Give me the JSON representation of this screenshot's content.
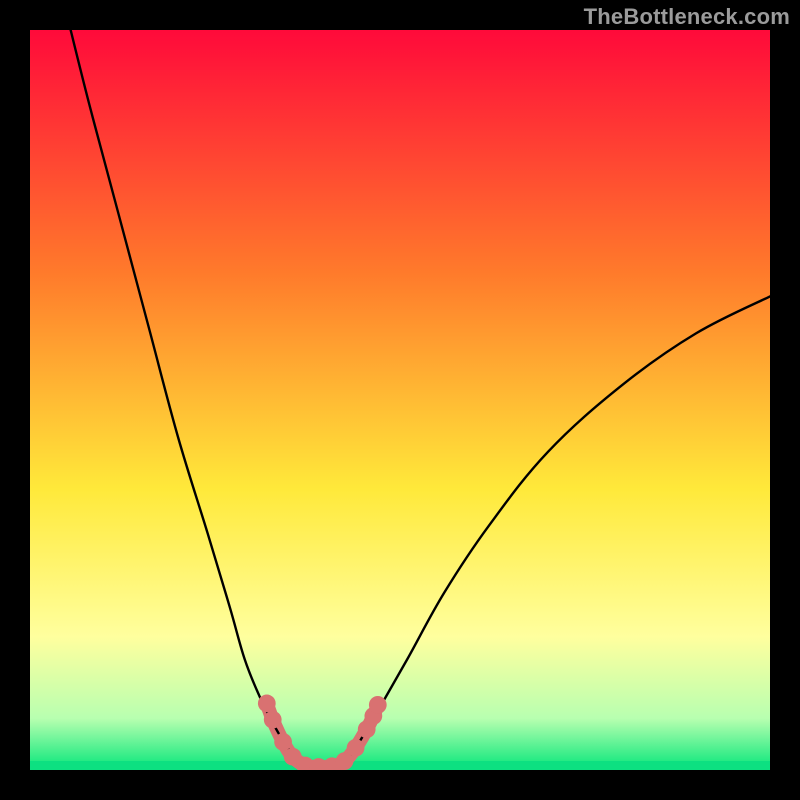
{
  "watermark": "TheBottleneck.com",
  "chart_data": {
    "type": "line",
    "title": "",
    "xlabel": "",
    "ylabel": "",
    "xlim": [
      0,
      100
    ],
    "ylim": [
      0,
      100
    ],
    "left_curve": {
      "x": [
        5,
        8,
        12,
        16,
        20,
        24,
        27,
        29,
        31,
        33,
        34.5,
        36,
        37
      ],
      "y": [
        102,
        90,
        75,
        60,
        45,
        32,
        22,
        15,
        10,
        6,
        3.5,
        1.5,
        0.5
      ]
    },
    "right_curve": {
      "x": [
        42,
        44,
        47,
        51,
        56,
        62,
        70,
        80,
        90,
        100
      ],
      "y": [
        0.5,
        3,
        8,
        15,
        24,
        33,
        43,
        52,
        59,
        64
      ]
    },
    "beads": [
      {
        "x": 32.0,
        "y": 9.0,
        "r": 1.2
      },
      {
        "x": 32.8,
        "y": 6.8,
        "r": 1.2
      },
      {
        "x": 34.2,
        "y": 3.8,
        "r": 1.2
      },
      {
        "x": 35.5,
        "y": 1.8,
        "r": 1.2
      },
      {
        "x": 37.2,
        "y": 0.6,
        "r": 1.2
      },
      {
        "x": 39.0,
        "y": 0.4,
        "r": 1.2
      },
      {
        "x": 40.8,
        "y": 0.5,
        "r": 1.2
      },
      {
        "x": 42.5,
        "y": 1.2,
        "r": 1.2
      },
      {
        "x": 44.0,
        "y": 3.0,
        "r": 1.2
      },
      {
        "x": 45.5,
        "y": 5.5,
        "r": 1.2
      },
      {
        "x": 46.4,
        "y": 7.3,
        "r": 1.2
      },
      {
        "x": 47.0,
        "y": 8.8,
        "r": 1.2
      }
    ],
    "colors": {
      "gradient_top": "#ff0a3a",
      "gradient_mid1": "#ff7b2b",
      "gradient_mid2": "#ffe93a",
      "gradient_low1": "#ffff9e",
      "gradient_low2": "#b8ffb0",
      "gradient_bottom": "#05e67a",
      "curve": "#000000",
      "beads": "#d97171",
      "bottom_band": "#0de081"
    }
  }
}
